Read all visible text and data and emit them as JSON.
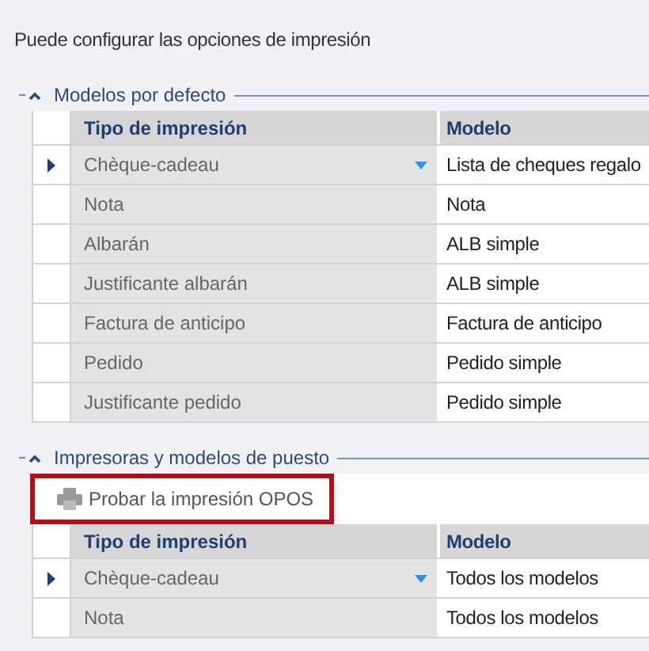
{
  "intro": "Puede configurar las opciones de impresión",
  "sections": [
    {
      "title": "Modelos por defecto",
      "expanded": true,
      "columns": [
        "Tipo de impresión",
        "Modelo"
      ],
      "rows": [
        {
          "type": "Chèque-cadeau",
          "model": "Lista de cheques regalo",
          "current": true
        },
        {
          "type": "Nota",
          "model": "Nota",
          "current": false
        },
        {
          "type": "Albarán",
          "model": "ALB simple",
          "current": false
        },
        {
          "type": "Justificante albarán",
          "model": "ALB simple",
          "current": false
        },
        {
          "type": "Factura de anticipo",
          "model": "Factura de anticipo",
          "current": false
        },
        {
          "type": "Pedido",
          "model": "Pedido simple",
          "current": false
        },
        {
          "type": "Justificante pedido",
          "model": "Pedido simple",
          "current": false
        }
      ]
    },
    {
      "title": "Impresoras y modelos de puesto",
      "expanded": true,
      "toolbar": {
        "label": "Probar la impresión OPOS",
        "highlighted": true
      },
      "columns": [
        "Tipo de impresión",
        "Modelo"
      ],
      "rows": [
        {
          "type": "Chèque-cadeau",
          "model": "Todos los modelos",
          "current": true
        },
        {
          "type": "Nota",
          "model": "Todos los modelos",
          "current": false
        }
      ]
    }
  ]
}
